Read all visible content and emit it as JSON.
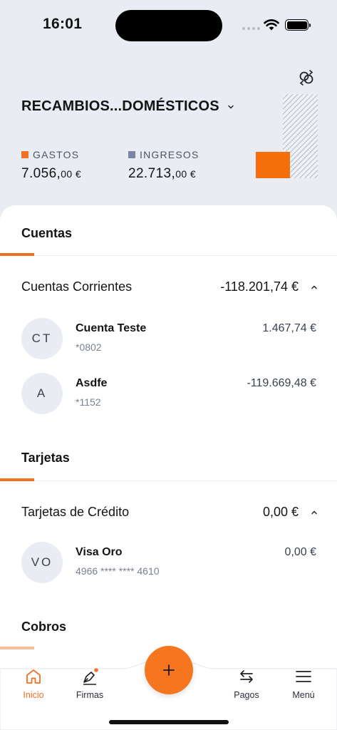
{
  "status": {
    "time": "16:01"
  },
  "header": {
    "company": "RECAMBIOS...DOMÉSTICOS",
    "expenses": {
      "label": "GASTOS",
      "amount": "7.056,",
      "decimals": "00 €",
      "color": "#f27024"
    },
    "income": {
      "label": "INGRESOS",
      "amount": "22.713,",
      "decimals": "00 €",
      "color": "#7b85a6"
    }
  },
  "sections": {
    "accounts": {
      "title": "Cuentas",
      "group_label": "Cuentas Corrientes",
      "group_total": "-118.201,74 €",
      "items": [
        {
          "initials": "CT",
          "name": "Cuenta Teste",
          "number": "*0802",
          "balance": "1.467,74 €"
        },
        {
          "initials": "A",
          "name": "Asdfe",
          "number": "*1152",
          "balance": "-119.669,48 €"
        }
      ]
    },
    "cards": {
      "title": "Tarjetas",
      "group_label": "Tarjetas de Crédito",
      "group_total": "0,00 €",
      "items": [
        {
          "initials": "VO",
          "name": "Visa Oro",
          "number": "4966 **** **** 4610",
          "balance": "0,00 €"
        }
      ]
    },
    "collections": {
      "title": "Cobros"
    }
  },
  "nav": {
    "home": "Inicio",
    "signatures": "Firmas",
    "payments": "Pagos",
    "menu": "Menú",
    "accent": "#f27024"
  }
}
